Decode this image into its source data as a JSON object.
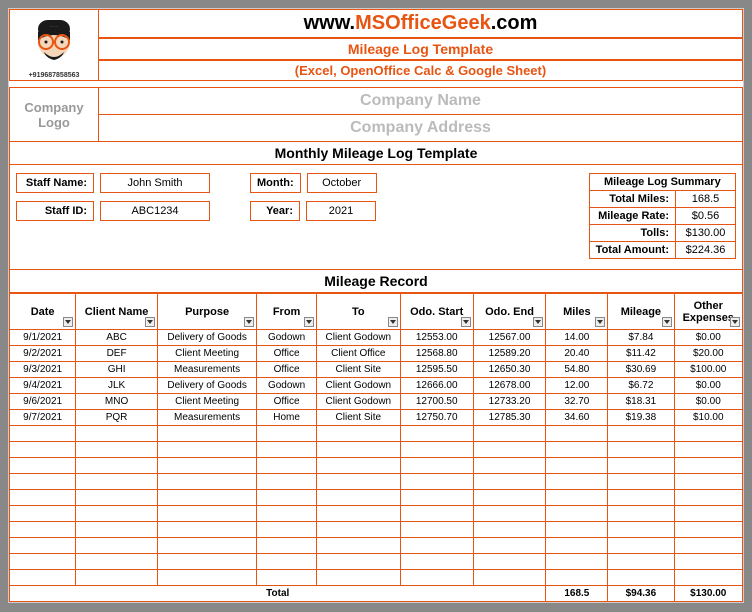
{
  "header": {
    "url_prefix": "www.",
    "url_main": "MSOfficeGeek",
    "url_suffix": ".com",
    "title": "Mileage Log Template",
    "subtitle": "(Excel, OpenOffice Calc & Google Sheet)",
    "phone": "+919687858563"
  },
  "company": {
    "logo_label": "Company Logo",
    "name_placeholder": "Company Name",
    "address_placeholder": "Company Address"
  },
  "section_title": "Monthly Mileage Log Template",
  "staff": {
    "name_label": "Staff Name:",
    "name": "John Smith",
    "id_label": "Staff ID:",
    "id": "ABC1234"
  },
  "period": {
    "month_label": "Month:",
    "month": "October",
    "year_label": "Year:",
    "year": "2021"
  },
  "summary": {
    "title": "Mileage Log Summary",
    "rows": [
      {
        "label": "Total Miles:",
        "value": "168.5"
      },
      {
        "label": "Mileage Rate:",
        "value": "$0.56"
      },
      {
        "label": "Tolls:",
        "value": "$130.00"
      },
      {
        "label": "Total Amount:",
        "value": "$224.36"
      }
    ]
  },
  "record_title": "Mileage Record",
  "columns": [
    "Date",
    "Client Name",
    "Purpose",
    "From",
    "To",
    "Odo. Start",
    "Odo. End",
    "Miles",
    "Mileage",
    "Other Expenses"
  ],
  "rows": [
    {
      "date": "9/1/2021",
      "client": "ABC",
      "purpose": "Delivery of Goods",
      "from": "Godown",
      "to": "Client Godown",
      "ostart": "12553.00",
      "oend": "12567.00",
      "miles": "14.00",
      "mileage": "$7.84",
      "other": "$0.00"
    },
    {
      "date": "9/2/2021",
      "client": "DEF",
      "purpose": "Client Meeting",
      "from": "Office",
      "to": "Client Office",
      "ostart": "12568.80",
      "oend": "12589.20",
      "miles": "20.40",
      "mileage": "$11.42",
      "other": "$20.00"
    },
    {
      "date": "9/3/2021",
      "client": "GHI",
      "purpose": "Measurements",
      "from": "Office",
      "to": "Client Site",
      "ostart": "12595.50",
      "oend": "12650.30",
      "miles": "54.80",
      "mileage": "$30.69",
      "other": "$100.00"
    },
    {
      "date": "9/4/2021",
      "client": "JLK",
      "purpose": "Delivery of Goods",
      "from": "Godown",
      "to": "Client Godown",
      "ostart": "12666.00",
      "oend": "12678.00",
      "miles": "12.00",
      "mileage": "$6.72",
      "other": "$0.00"
    },
    {
      "date": "9/6/2021",
      "client": "MNO",
      "purpose": "Client Meeting",
      "from": "Office",
      "to": "Client Godown",
      "ostart": "12700.50",
      "oend": "12733.20",
      "miles": "32.70",
      "mileage": "$18.31",
      "other": "$0.00"
    },
    {
      "date": "9/7/2021",
      "client": "PQR",
      "purpose": "Measurements",
      "from": "Home",
      "to": "Client Site",
      "ostart": "12750.70",
      "oend": "12785.30",
      "miles": "34.60",
      "mileage": "$19.38",
      "other": "$10.00"
    }
  ],
  "empty_rows": 10,
  "footer": {
    "label": "Total",
    "miles": "168.5",
    "mileage": "$94.36",
    "other": "$130.00"
  }
}
